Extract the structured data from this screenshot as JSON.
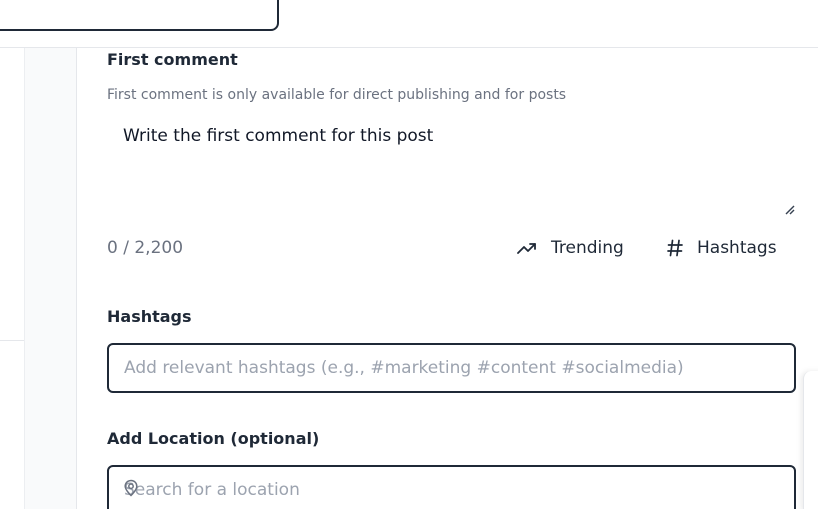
{
  "first_comment": {
    "title": "First comment",
    "helper": "First comment is only available for direct publishing and for posts",
    "placeholder": "Write the first comment for this post",
    "value": "",
    "counter": "0 / 2,200",
    "trending_label": "Trending",
    "hashtags_label": "Hashtags",
    "trending_icon": "trending-up-icon",
    "hashtags_icon": "hash-icon"
  },
  "hashtags": {
    "title": "Hashtags",
    "placeholder": "Add relevant hashtags (e.g., #marketing #content #socialmedia)",
    "value": ""
  },
  "location": {
    "title": "Add Location (optional)",
    "placeholder": "Search for a location",
    "value": "",
    "icon": "map-pin-icon"
  },
  "colors": {
    "text": "#1f2937",
    "muted": "#6b7280",
    "placeholder": "#9ca3af",
    "border": "#1f2937",
    "divider": "#e5e7eb"
  }
}
